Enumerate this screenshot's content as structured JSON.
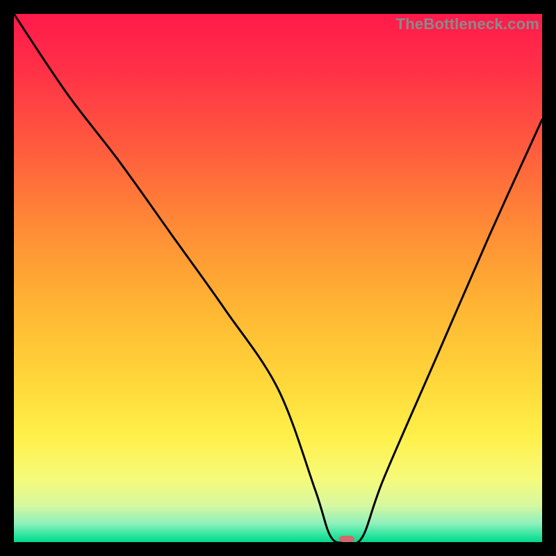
{
  "watermark": "TheBottleneck.com",
  "chart_data": {
    "type": "line",
    "title": "",
    "xlabel": "",
    "ylabel": "",
    "xlim": [
      0,
      100
    ],
    "ylim": [
      0,
      100
    ],
    "grid": false,
    "legend": false,
    "series": [
      {
        "name": "curve",
        "x": [
          0,
          10,
          20,
          30,
          40,
          50,
          57,
          60,
          63,
          66,
          70,
          80,
          90,
          100
        ],
        "y": [
          100,
          85,
          72,
          58,
          44,
          29,
          10,
          1,
          0,
          1,
          12,
          35,
          58,
          80
        ]
      }
    ],
    "marker": {
      "x_pct": 63,
      "y_pct": 0,
      "w_pct": 3.0,
      "h_pct": 1.2,
      "color": "#d16a6a"
    },
    "gradient_stops": [
      {
        "offset": 0.0,
        "color": "#ff1a4b"
      },
      {
        "offset": 0.1,
        "color": "#ff2f47"
      },
      {
        "offset": 0.25,
        "color": "#ff5a3e"
      },
      {
        "offset": 0.4,
        "color": "#ff8a36"
      },
      {
        "offset": 0.55,
        "color": "#ffb433"
      },
      {
        "offset": 0.7,
        "color": "#ffd83a"
      },
      {
        "offset": 0.8,
        "color": "#fff04a"
      },
      {
        "offset": 0.88,
        "color": "#f6fa7a"
      },
      {
        "offset": 0.93,
        "color": "#d7f8a0"
      },
      {
        "offset": 0.965,
        "color": "#8ef0bc"
      },
      {
        "offset": 0.985,
        "color": "#35e6a2"
      },
      {
        "offset": 1.0,
        "color": "#00d98a"
      }
    ]
  }
}
